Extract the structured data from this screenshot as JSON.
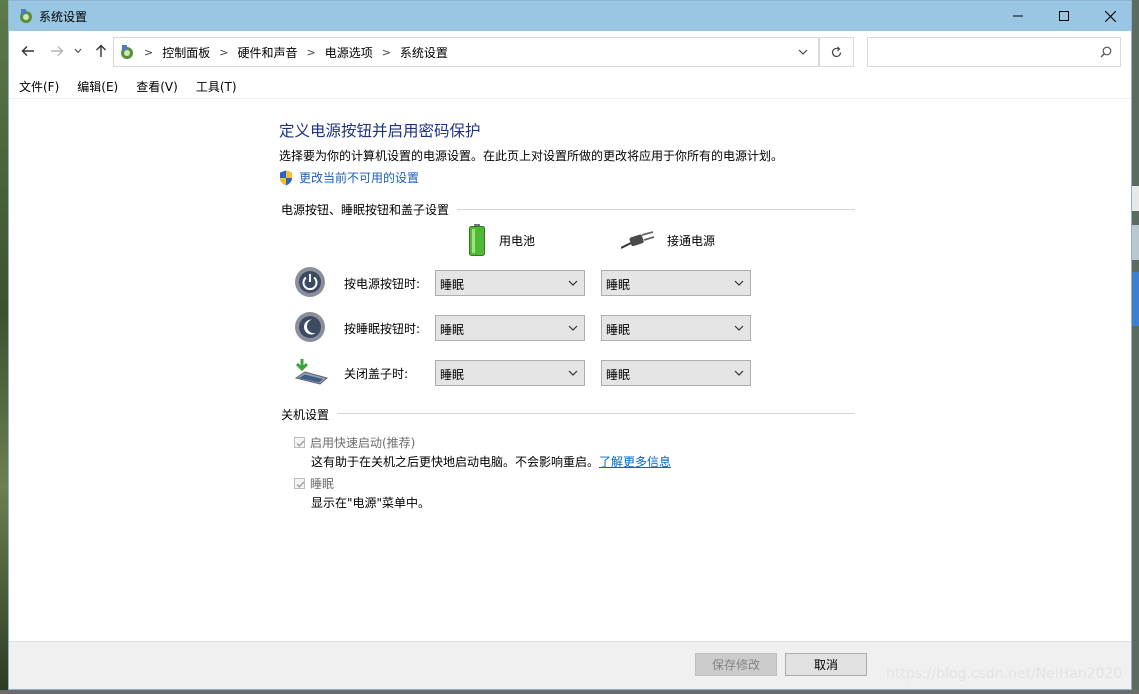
{
  "window": {
    "title": "系统设置"
  },
  "breadcrumb": [
    "控制面板",
    "硬件和声音",
    "电源选项",
    "系统设置"
  ],
  "search": {
    "placeholder": ""
  },
  "menu": [
    "文件(F)",
    "编辑(E)",
    "查看(V)",
    "工具(T)"
  ],
  "header": {
    "title": "定义电源按钮并启用密码保护",
    "description": "选择要为你的计算机设置的电源设置。在此页上对设置所做的更改将应用于你所有的电源计划。",
    "change_link": "更改当前不可用的设置"
  },
  "power_section": {
    "title": "电源按钮、睡眠按钮和盖子设置",
    "col_battery": "用电池",
    "col_plugged": "接通电源",
    "rows": [
      {
        "label": "按电源按钮时:",
        "battery": "睡眠",
        "plugged": "睡眠"
      },
      {
        "label": "按睡眠按钮时:",
        "battery": "睡眠",
        "plugged": "睡眠"
      },
      {
        "label": "关闭盖子时:",
        "battery": "睡眠",
        "plugged": "睡眠"
      }
    ]
  },
  "shutdown_section": {
    "title": "关机设置",
    "fast_startup": {
      "label": "启用快速启动(推荐)",
      "desc": "这有助于在关机之后更快地启动电脑。不会影响重启。",
      "link": "了解更多信息",
      "checked": true
    },
    "sleep": {
      "label": "睡眠",
      "desc": "显示在\"电源\"菜单中。",
      "checked": true
    }
  },
  "footer": {
    "save": "保存修改",
    "cancel": "取消"
  },
  "watermark": "https://blog.csdn.net/NeiHan2020"
}
